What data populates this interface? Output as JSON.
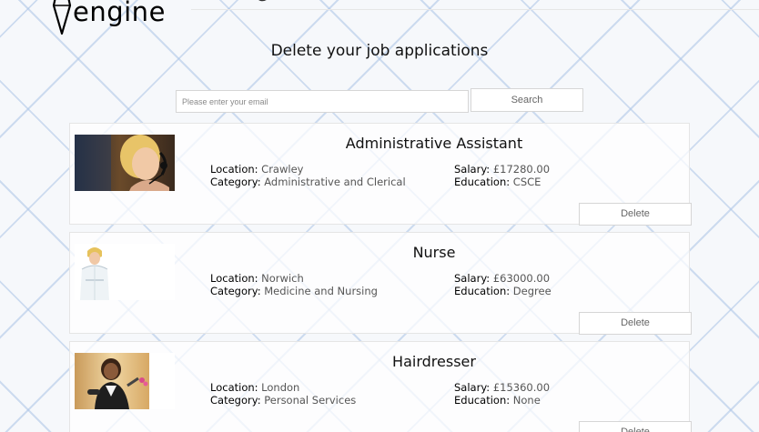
{
  "brand": {
    "logo_text": "engine"
  },
  "page": {
    "title": "Delete your job applications"
  },
  "search": {
    "placeholder": "Please enter your email",
    "value": "",
    "button_label": "Search"
  },
  "labels": {
    "location": "Location: ",
    "category": "Category: ",
    "salary": "Salary: ",
    "education": "Education: "
  },
  "jobs": [
    {
      "title": "Administrative Assistant",
      "location": "Crawley",
      "category": "Administrative and Clerical",
      "salary": "£17280.00",
      "education": "CSCE",
      "delete_label": "Delete",
      "image": "call-centre-operator-photo"
    },
    {
      "title": "Nurse",
      "location": "Norwich",
      "category": "Medicine and Nursing",
      "salary": "£63000.00",
      "education": "Degree",
      "delete_label": "Delete",
      "image": "nurse-photo"
    },
    {
      "title": "Hairdresser",
      "location": "London",
      "category": "Personal Services",
      "salary": "£15360.00",
      "education": "None",
      "delete_label": "Delete",
      "image": "hairdresser-photo"
    }
  ]
}
